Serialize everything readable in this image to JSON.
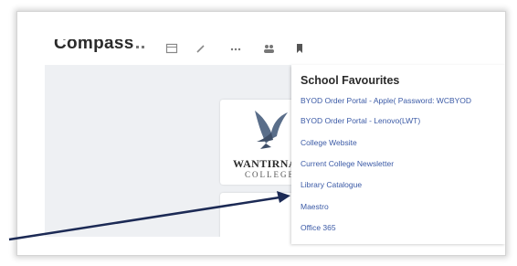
{
  "app": {
    "title": "Compass"
  },
  "logo": {
    "line1": "WANTIRNA",
    "line2": "COLLEGE"
  },
  "favourites": {
    "title": "School Favourites",
    "items": [
      "BYOD Order Portal - Apple( Password: WCBYOD",
      "BYOD Order Portal - Lenovo(LWT)",
      "College Website",
      "Current College Newsletter",
      "Library Catalogue",
      "Maestro",
      "Office 365"
    ]
  },
  "colors": {
    "link": "#3b5aa6",
    "arrow": "#1c2a55",
    "panel_bg": "#eef0f3"
  },
  "icons": [
    "grid-icon",
    "calendar-icon",
    "edit-icon",
    "more-icon",
    "people-icon",
    "bookmark-icon"
  ]
}
